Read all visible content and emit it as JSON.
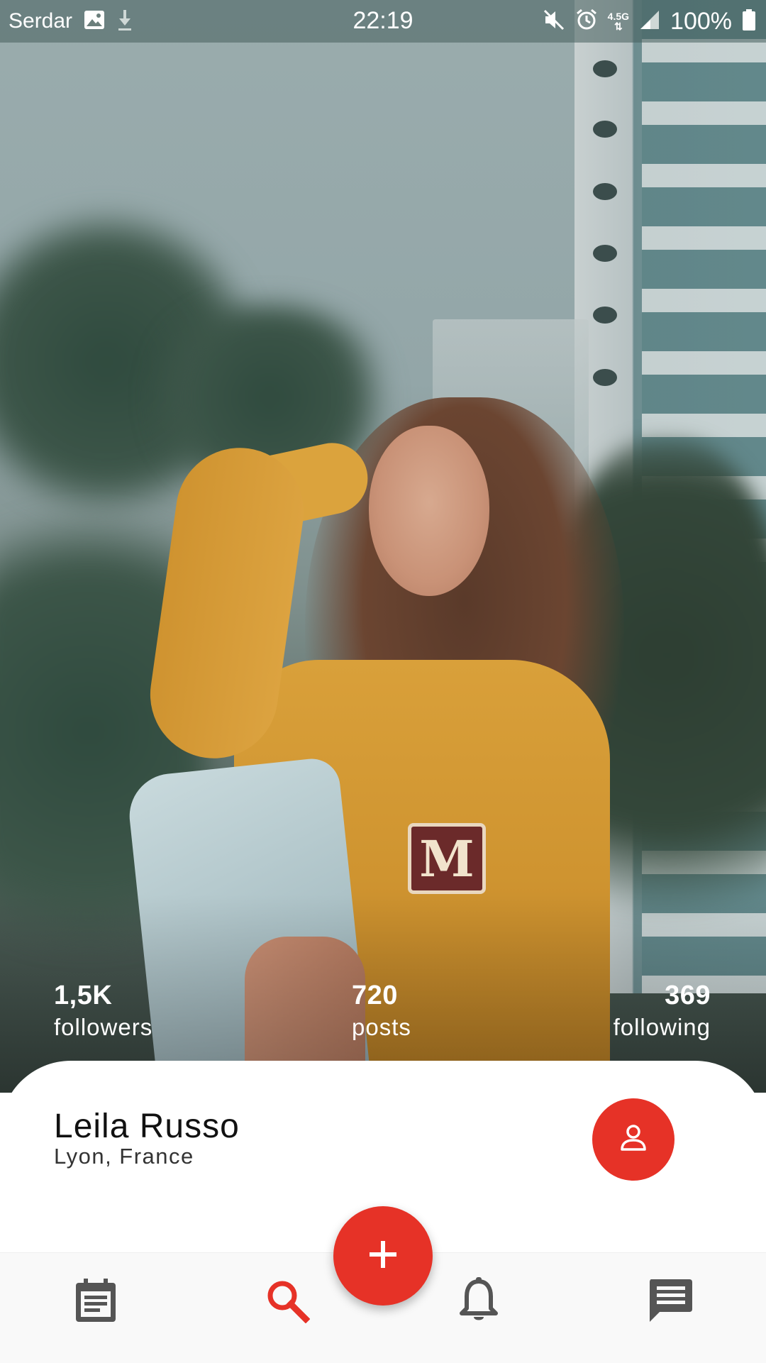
{
  "status_bar": {
    "carrier": "Serdar",
    "time": "22:19",
    "network": "4.5G",
    "battery": "100%"
  },
  "profile": {
    "name": "Leila Russo",
    "location": "Lyon, France",
    "stats": [
      {
        "value": "1,5K",
        "label": "followers"
      },
      {
        "value": "720",
        "label": "posts"
      },
      {
        "value": "369",
        "label": "following"
      }
    ]
  },
  "photo": {
    "patch_letter": "M"
  },
  "bottom_nav": {
    "items": [
      {
        "icon": "calendar-icon",
        "active": false
      },
      {
        "icon": "search-icon",
        "active": true
      },
      {
        "icon": "bell-icon",
        "active": false
      },
      {
        "icon": "chat-icon",
        "active": false
      }
    ],
    "fab_icon": "plus-icon"
  },
  "colors": {
    "accent": "#e63227",
    "nav_icon": "#555555",
    "text_primary": "#111111"
  }
}
